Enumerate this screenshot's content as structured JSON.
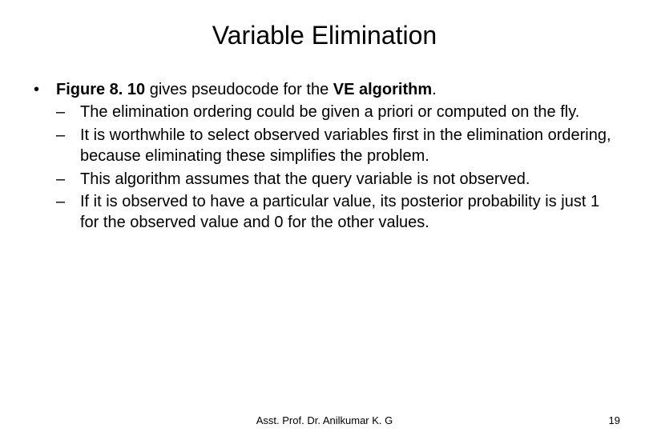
{
  "title": "Variable Elimination",
  "intro": {
    "fig_ref": "Figure 8. 10",
    "mid_text": " gives pseudocode for the ",
    "algo": "VE algorithm",
    "end_text": "."
  },
  "sub_bullets": [
    "The elimination ordering could be given a priori or computed on the fly.",
    "It is worthwhile to select observed variables first in the elimination ordering, because eliminating these simplifies the problem.",
    "This algorithm assumes that the query variable is not observed.",
    "If it is observed to have a particular value, its posterior probability is just 1 for the observed value and 0 for the other values."
  ],
  "markers": {
    "bullet": "•",
    "dash": "–"
  },
  "footer": {
    "author": "Asst. Prof. Dr. Anilkumar K. G",
    "page": "19"
  }
}
